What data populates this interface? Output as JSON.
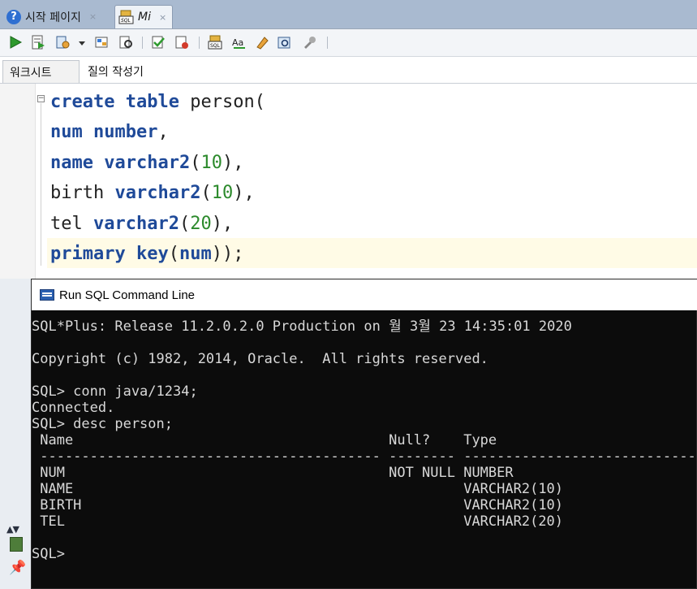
{
  "tabs": [
    {
      "label": "시작 페이지",
      "close": "×"
    },
    {
      "label": "Mi",
      "close": "×"
    }
  ],
  "toolbar": {
    "icons": [
      "run-statement-icon",
      "run-script-icon",
      "autotrace-icon",
      "dropdown-arrow-icon",
      "explain-plan-icon",
      "sql-tuning-icon",
      "commit-icon",
      "rollback-icon",
      "sql-history-icon",
      "uppercase-icon",
      "clear-icon",
      "find-replace-icon",
      "tools-icon"
    ]
  },
  "subtabs": [
    "워크시트",
    "질의 작성기"
  ],
  "editor": {
    "fold_marker": "−"
  },
  "cmdline": {
    "title": "Run SQL Command Line",
    "banner": "SQL*Plus: Release 11.2.0.2.0 Production on 월 3월 23 14:35:01 2020",
    "copyright": "Copyright (c) 1982, 2014, Oracle.  All rights reserved.",
    "cmd1": "SQL> conn java/1234;",
    "result1": "Connected.",
    "cmd2": "SQL> desc person;",
    "desc_header": " Name                                      Null?    Type",
    "desc_rule": " ----------------------------------------- -------- ----------------------------",
    "rows": [
      " NUM                                       NOT NULL NUMBER",
      " NAME                                               VARCHAR2(10)",
      " BIRTH                                              VARCHAR2(10)",
      " TEL                                                VARCHAR2(20)"
    ],
    "prompt": "SQL>"
  }
}
